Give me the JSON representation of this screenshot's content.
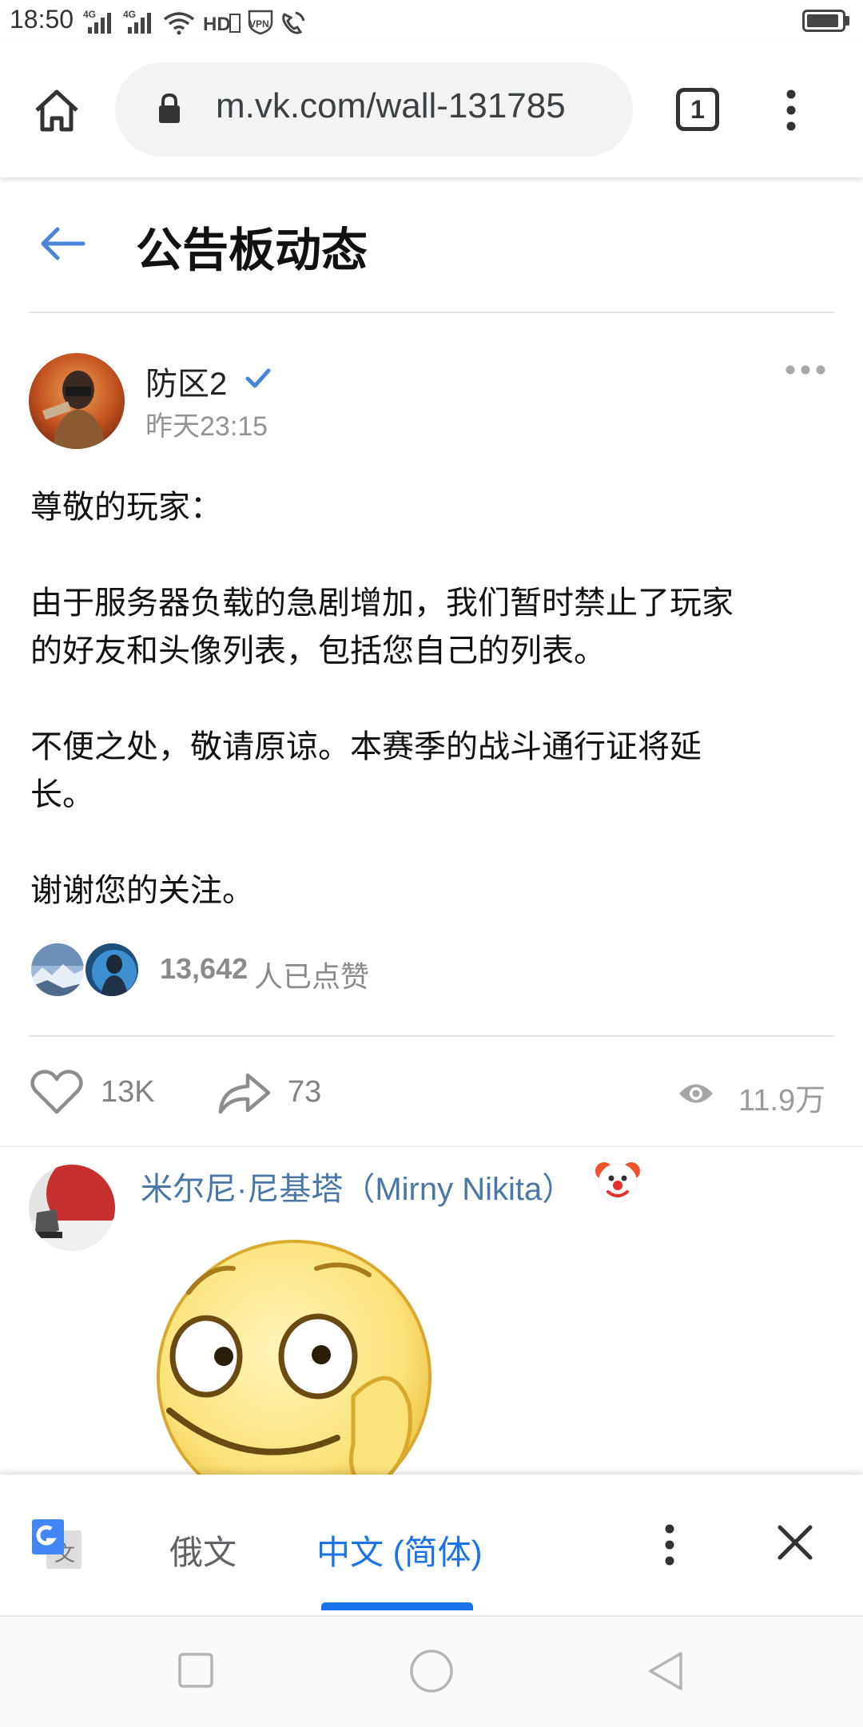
{
  "status_bar": {
    "time": "18:50",
    "icons": [
      "4g-signal-icon",
      "4g-signal-icon",
      "wifi-icon",
      "hd-icon",
      "vpn-icon",
      "call-icon"
    ],
    "signal_label_1": "4G",
    "signal_label_2": "4G",
    "hd_label": "HD",
    "vpn_label": "VPN"
  },
  "browser": {
    "url": "m.vk.com/wall-131785",
    "tab_count": "1"
  },
  "page": {
    "title": "公告板动态"
  },
  "post": {
    "author": "防区2",
    "time": "昨天23:15",
    "body_lines": [
      "尊敬的玩家：",
      "由于服务器负载的急剧增加，我们暂时禁止了玩家",
      "的好友和头像列表，包括您自己的列表。",
      "不便之处，敬请原谅。本赛季的战斗通行证将延",
      "长。",
      "谢谢您的关注。"
    ],
    "likes_count": "13,642",
    "likes_suffix": "人已点赞",
    "actions": {
      "like_count": "13K",
      "share_count": "73",
      "views": "11.9万"
    }
  },
  "comment": {
    "author": "米尔尼·尼基塔（Mirny Nikita）"
  },
  "translate_bar": {
    "source_lang": "俄文",
    "target_lang": "中文 (简体)",
    "icon_glyph": "文"
  },
  "colors": {
    "accent_blue": "#1a73e8",
    "vk_blue": "#4a76a8",
    "muted_gray": "#828282"
  }
}
